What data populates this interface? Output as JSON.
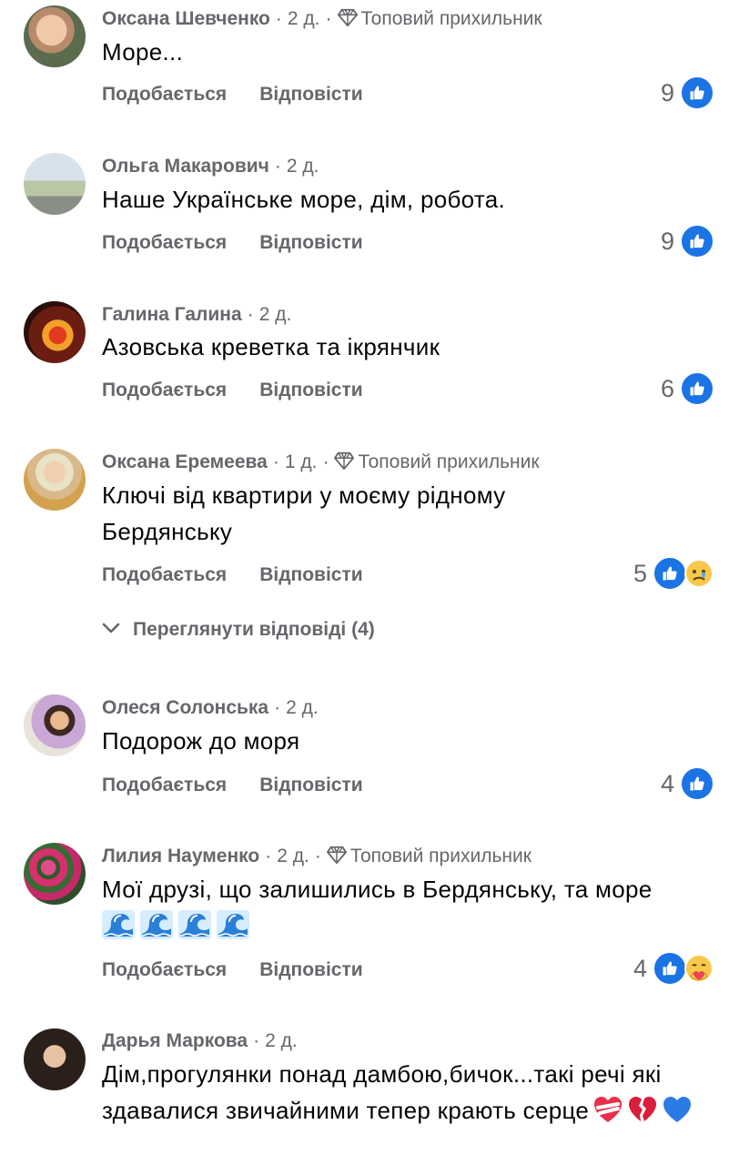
{
  "labels": {
    "like": "Подобається",
    "reply": "Відповісти"
  },
  "colors": {
    "like_blue": "#1b74e4",
    "meta_gray": "#65676b",
    "text": "#050505"
  },
  "comments": [
    {
      "name": "Оксана Шевченко",
      "time": "2 д.",
      "badge": "Топовий прихильник",
      "text": "Море...",
      "count": "9",
      "reactions": [
        "like-icon"
      ]
    },
    {
      "name": "Ольга Макарович",
      "time": "2 д.",
      "badge": "",
      "text": "Наше Українське море, дім, робота.",
      "count": "9",
      "reactions": [
        "like-icon"
      ]
    },
    {
      "name": "Галина Галина",
      "time": "2 д.",
      "badge": "",
      "text": "Азовська креветка та ікрянчик",
      "count": "6",
      "reactions": [
        "like-icon"
      ]
    },
    {
      "name": "Оксана Еремеева",
      "time": "1 д.",
      "badge": "Топовий прихильник",
      "text": "Ключі від квартири у моєму рідному Бердянську",
      "count": "5",
      "reactions": [
        "like-icon",
        "sad-icon"
      ],
      "view_replies": "Переглянути відповіді (4)"
    },
    {
      "name": "Олеся Солонська",
      "time": "2 д.",
      "badge": "",
      "text": "Подорож до моря",
      "count": "4",
      "reactions": [
        "like-icon"
      ]
    },
    {
      "name": "Лилия Науменко",
      "time": "2 д.",
      "badge": "Топовий прихильник",
      "text": "Мої друзі, що залишились в Бердянську, та море",
      "emoji_after": [
        "wave-icon",
        "wave-icon",
        "wave-icon",
        "wave-icon"
      ],
      "count": "4",
      "reactions": [
        "like-icon",
        "care-icon"
      ]
    },
    {
      "name": "Дарья Маркова",
      "time": "2 д.",
      "badge": "",
      "text": "Дім,прогулянки понад дамбою,бичок...такі речі які здавалися звичайними тепер крають серце",
      "emoji_after": [
        "mending-heart-icon",
        "broken-heart-icon",
        "blue-heart-icon"
      ]
    }
  ]
}
